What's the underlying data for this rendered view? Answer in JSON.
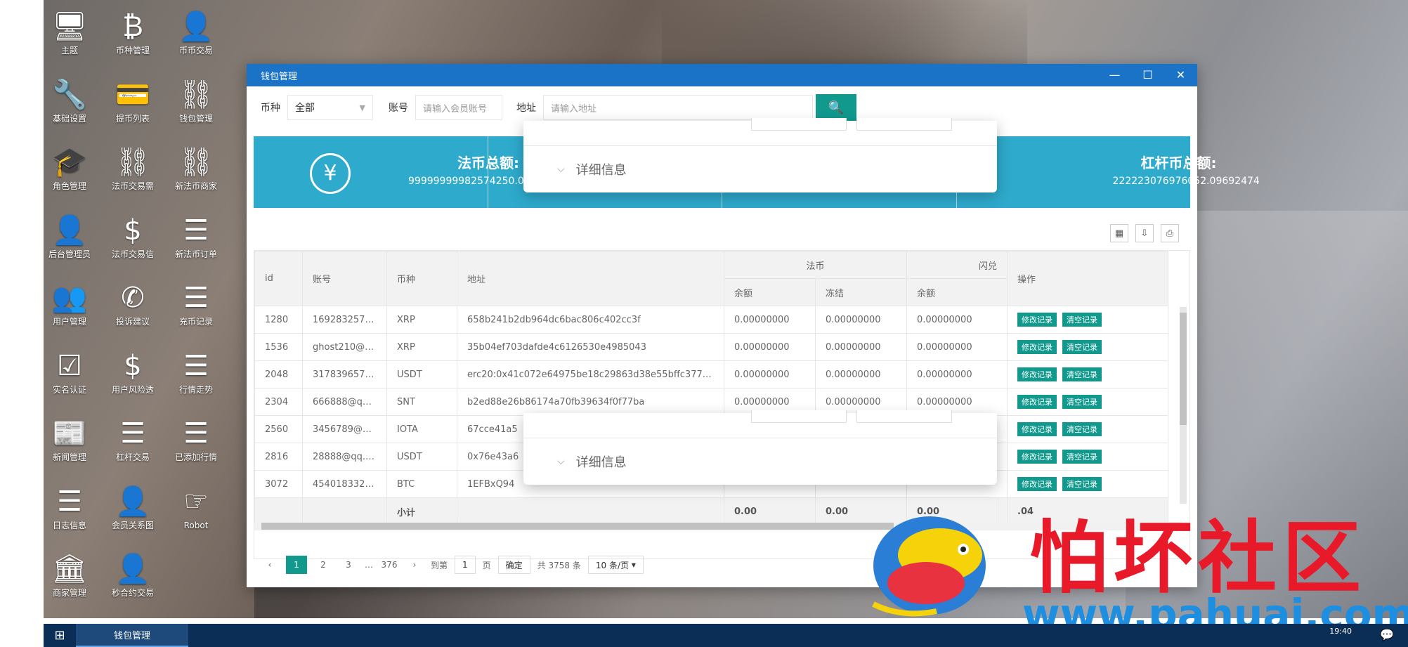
{
  "desktop_icons": [
    {
      "label": "主题",
      "icon": "monitor-icon",
      "glyph": "🖥"
    },
    {
      "label": "币种管理",
      "icon": "bitcoin-icon",
      "glyph": "₿"
    },
    {
      "label": "币币交易",
      "icon": "add-user-icon",
      "glyph": "👤"
    },
    {
      "label": "基础设置",
      "icon": "wrench-icon",
      "glyph": "🔧"
    },
    {
      "label": "提币列表",
      "icon": "card-icon",
      "glyph": "💳"
    },
    {
      "label": "钱包管理",
      "icon": "link-icon",
      "glyph": "⛓"
    },
    {
      "label": "角色管理",
      "icon": "graduation-cap-icon",
      "glyph": "🎓"
    },
    {
      "label": "法币交易需",
      "icon": "link-icon",
      "glyph": "⛓"
    },
    {
      "label": "新法币商家",
      "icon": "link-icon",
      "glyph": "⛓"
    },
    {
      "label": "后台管理员",
      "icon": "user-circle-icon",
      "glyph": "👤"
    },
    {
      "label": "法币交易信",
      "icon": "dollar-icon",
      "glyph": "$"
    },
    {
      "label": "新法币订单",
      "icon": "list-icon",
      "glyph": "☰"
    },
    {
      "label": "用户管理",
      "icon": "users-icon",
      "glyph": "👥"
    },
    {
      "label": "投诉建议",
      "icon": "phone-icon",
      "glyph": "✆"
    },
    {
      "label": "充币记录",
      "icon": "list-icon",
      "glyph": "☰"
    },
    {
      "label": "实名认证",
      "icon": "check-square-icon",
      "glyph": "☑"
    },
    {
      "label": "用户风险透",
      "icon": "dollar-icon",
      "glyph": "$"
    },
    {
      "label": "行情走势",
      "icon": "list-icon",
      "glyph": "☰"
    },
    {
      "label": "新闻管理",
      "icon": "newspaper-icon",
      "glyph": "📰"
    },
    {
      "label": "杠杆交易",
      "icon": "list-icon",
      "glyph": "☰"
    },
    {
      "label": "已添加行情",
      "icon": "list-icon",
      "glyph": "☰"
    },
    {
      "label": "日志信息",
      "icon": "list-icon",
      "glyph": "☰"
    },
    {
      "label": "会员关系图",
      "icon": "add-user-icon",
      "glyph": "👤"
    },
    {
      "label": "Robot",
      "icon": "hand-icon",
      "glyph": "☞"
    },
    {
      "label": "商家管理",
      "icon": "bank-icon",
      "glyph": "🏛"
    },
    {
      "label": "秒合约交易",
      "icon": "add-user-icon",
      "glyph": "👤"
    }
  ],
  "window": {
    "title": "钱包管理",
    "minimize": "—",
    "maximize": "☐",
    "close": "✕"
  },
  "filters": {
    "currency_label": "币种",
    "currency_value": "全部",
    "account_label": "账号",
    "account_placeholder": "请输入会员账号",
    "address_label": "地址",
    "address_placeholder": "请输入地址",
    "search_icon": "🔍"
  },
  "banner": {
    "fiat_icon": "¥",
    "fiat_title": "法币总额:",
    "fiat_value": "99999999982574250.0",
    "leverage_title": "杠杆币总额:",
    "leverage_value": "222223076976052.09692474"
  },
  "toolbar": {
    "columns_icon": "▦",
    "export_icon": "⇩",
    "print_icon": "⎙"
  },
  "table": {
    "headers": {
      "id": "id",
      "account": "账号",
      "currency": "币种",
      "address": "地址",
      "fiat_group": "法币",
      "flash_group": "闪兑",
      "operation": "操作",
      "balance": "余额",
      "frozen": "冻结",
      "balance2": "余额"
    },
    "rows": [
      {
        "id": "1280",
        "account": "169283257…",
        "currency": "XRP",
        "address": "658b241b2db964dc6bac806c402cc3f",
        "balance": "0.00000000",
        "frozen": "0.00000000",
        "balance2": "0.00000000"
      },
      {
        "id": "1536",
        "account": "ghost210@…",
        "currency": "XRP",
        "address": "35b04ef703dafde4c6126530e4985043",
        "balance": "0.00000000",
        "frozen": "0.00000000",
        "balance2": "0.00000000"
      },
      {
        "id": "2048",
        "account": "317839657…",
        "currency": "USDT",
        "address": "erc20:0x41c072e64975be18c29863d38e55bffc37747…",
        "balance": "0.00000000",
        "frozen": "0.00000000",
        "balance2": "0.00000000"
      },
      {
        "id": "2304",
        "account": "666888@q…",
        "currency": "SNT",
        "address": "b2ed88e26b86174a70fb39634f0f77ba",
        "balance": "0.00000000",
        "frozen": "0.00000000",
        "balance2": "0.00000000"
      },
      {
        "id": "2560",
        "account": "3456789@…",
        "currency": "IOTA",
        "address": "67cce41a5",
        "balance": "",
        "frozen": "",
        "balance2": ""
      },
      {
        "id": "2816",
        "account": "28888@qq.…",
        "currency": "USDT",
        "address": "0x76e43a6",
        "balance": "",
        "frozen": "",
        "balance2": ""
      },
      {
        "id": "3072",
        "account": "454018332…",
        "currency": "BTC",
        "address": "1EFBxQ94",
        "balance": "",
        "frozen": "",
        "balance2": ""
      }
    ],
    "edit_label": "修改记录",
    "clear_label": "清空记录",
    "subtotal_label": "小计",
    "subtotal_balance": "0.00",
    "subtotal_frozen": "0.00",
    "subtotal_balance2": "0.00",
    "subtotal_last": ".04"
  },
  "pager": {
    "prev": "‹",
    "p1": "1",
    "p2": "2",
    "p3": "3",
    "ellipsis": "…",
    "last": "376",
    "next": "›",
    "goto_label": "到第",
    "goto_value": "1",
    "page_unit": "页",
    "confirm": "确定",
    "total": "共 3758 条",
    "per_page": "10 条/页"
  },
  "popup": {
    "detail_label": "详细信息",
    "chevron": "⌵"
  },
  "taskbar": {
    "start_icon": "⊞",
    "task_label": "钱包管理",
    "clock": "19:40",
    "notify_icon": "💬"
  },
  "watermark": {
    "text": "怕坏社区",
    "url": "www.pahuai.com"
  },
  "colors": {
    "accent": "#11998e",
    "titlebar": "#1a73c7",
    "banner": "#2eaacc",
    "taskbar": "#0a2e55"
  }
}
